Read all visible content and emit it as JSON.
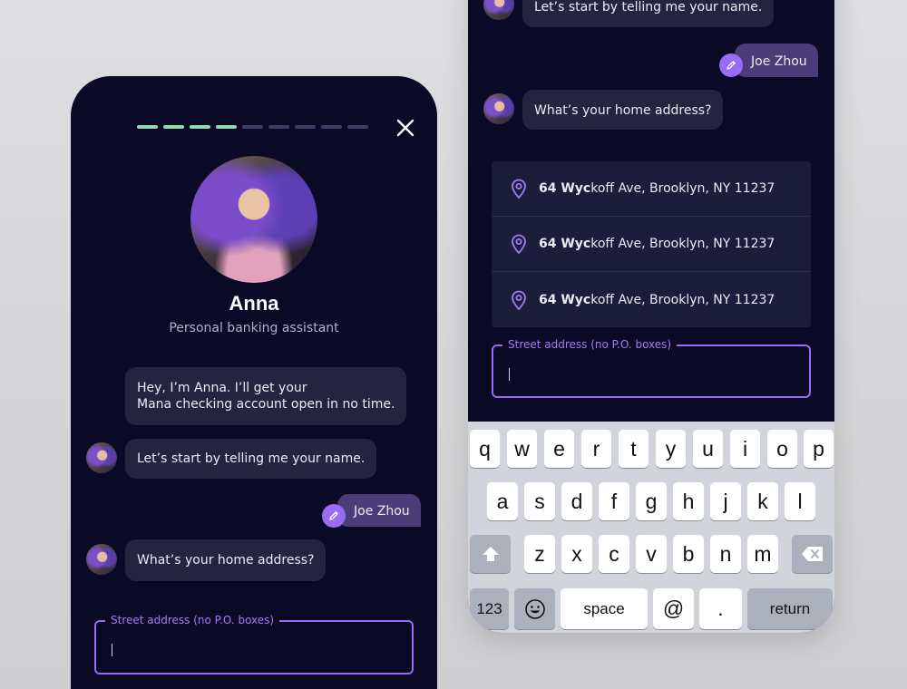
{
  "chat": {
    "progress": {
      "total_steps": 9,
      "completed_steps": 4
    },
    "agent": {
      "name": "Anna",
      "role": "Personal banking assistant"
    },
    "messages": {
      "greeting_line1": "Hey, I’m Anna. I’ll get your",
      "greeting_line2": "Mana checking account open in no time.",
      "ask_name": "Let’s start by telling me your name.",
      "user_name": "Joe Zhou",
      "ask_address": "What’s your home address?"
    },
    "address_field": {
      "label": "Street address (no P.O. boxes)",
      "value": ""
    },
    "suggestions": [
      {
        "match": "64 Wyc",
        "rest": "koff Ave, Brooklyn, NY 11237"
      },
      {
        "match": "64 Wyc",
        "rest": "koff Ave, Brooklyn, NY 11237"
      },
      {
        "match": "64 Wyc",
        "rest": "koff Ave, Brooklyn, NY 11237"
      }
    ]
  },
  "keyboard": {
    "row1": [
      "q",
      "w",
      "e",
      "r",
      "t",
      "y",
      "u",
      "i",
      "o",
      "p"
    ],
    "row2": [
      "a",
      "s",
      "d",
      "f",
      "g",
      "h",
      "j",
      "k",
      "l"
    ],
    "row3": [
      "z",
      "x",
      "c",
      "v",
      "b",
      "n",
      "m"
    ],
    "numbers_label": "123",
    "space_label": "space",
    "at_label": "@",
    "period_label": ".",
    "return_label": "return",
    "shift_icon": "shift-icon",
    "delete_icon": "delete-icon",
    "emoji_icon": "emoji-icon"
  },
  "colors": {
    "background": "#0a0a26",
    "bubble": "#24243f",
    "user_bubble": "#4b3d7a",
    "accent": "#9a6bf7",
    "progress_done": "#8fd9b3",
    "progress_todo": "#3d3d66"
  }
}
